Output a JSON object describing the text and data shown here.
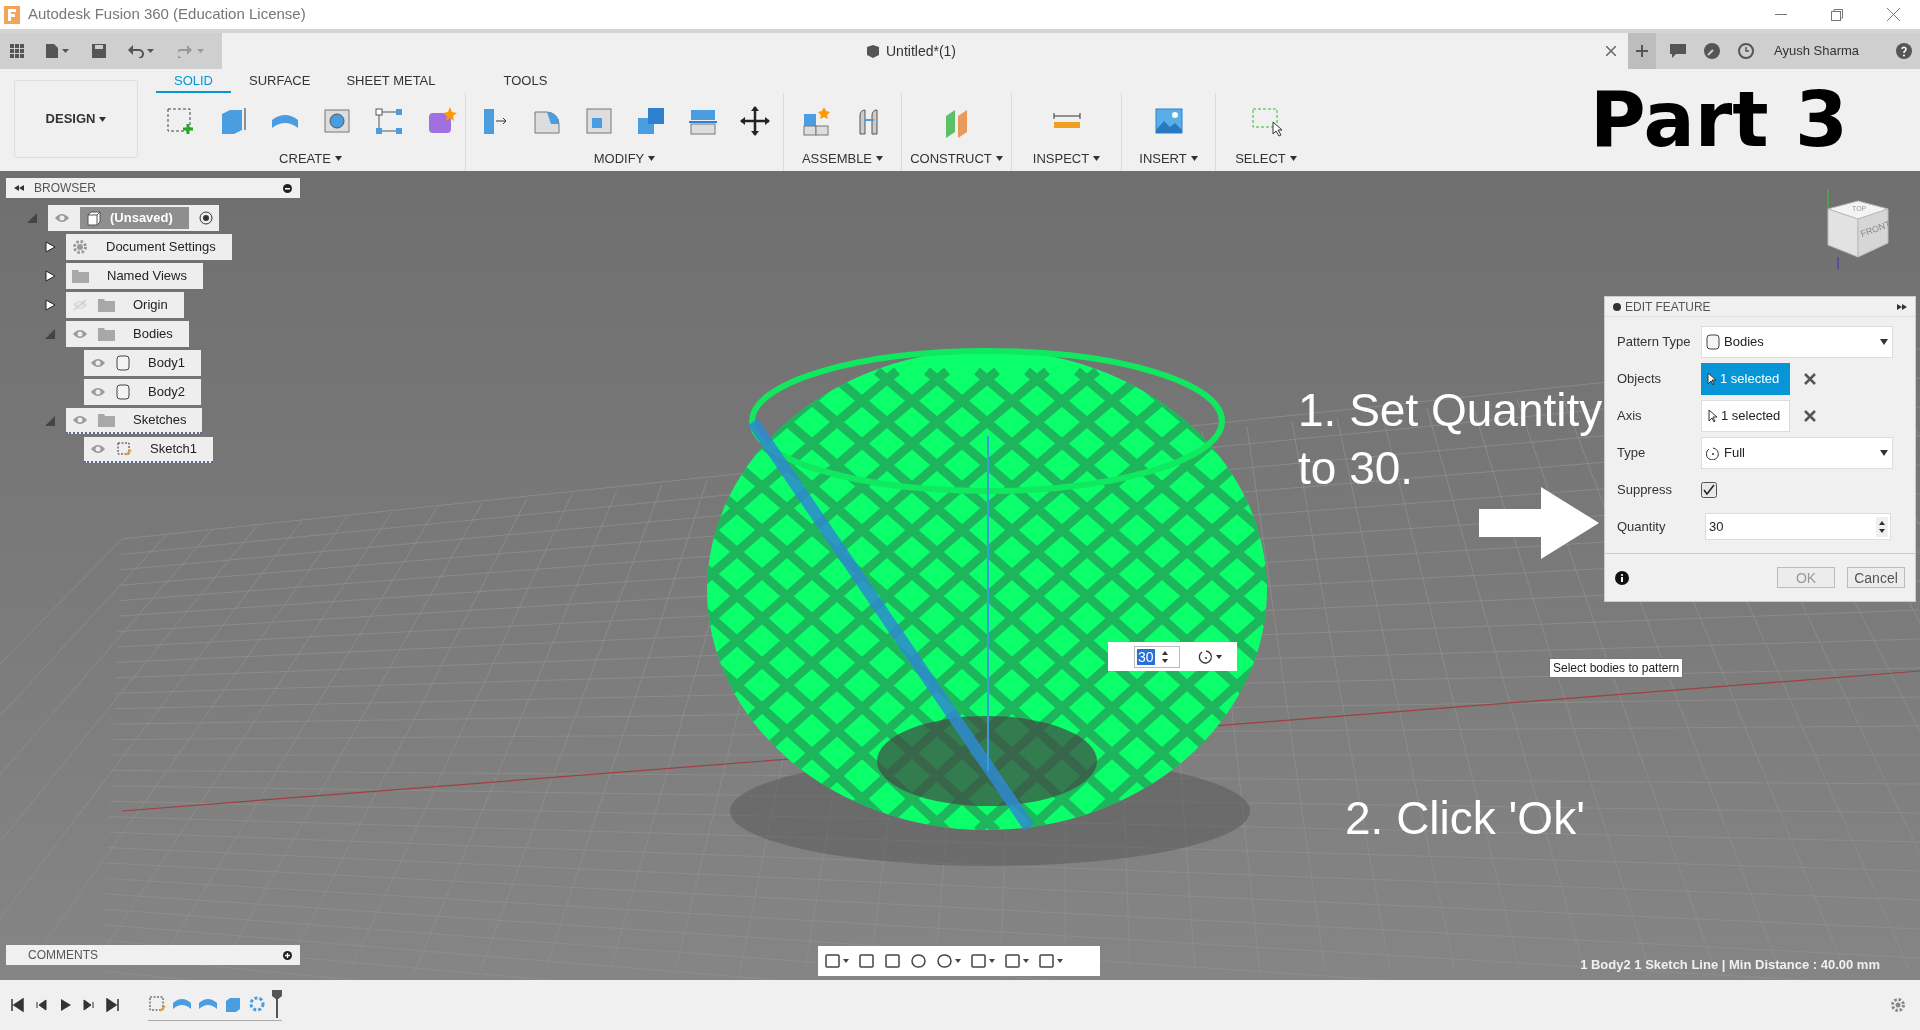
{
  "title_bar": {
    "title": "Autodesk Fusion 360 (Education License)"
  },
  "tab_bar": {
    "document_title": "Untitled*(1)",
    "user": "Ayush Sharma"
  },
  "toolbar": {
    "workspace": "DESIGN",
    "tabs": [
      {
        "label": "SOLID",
        "selected": true
      },
      {
        "label": "SURFACE",
        "selected": false
      },
      {
        "label": "SHEET METAL",
        "selected": false
      },
      {
        "label": "TOOLS",
        "selected": false
      }
    ],
    "groups": [
      {
        "label": "CREATE"
      },
      {
        "label": "MODIFY"
      },
      {
        "label": "ASSEMBLE"
      },
      {
        "label": "CONSTRUCT"
      },
      {
        "label": "INSPECT"
      },
      {
        "label": "INSERT"
      },
      {
        "label": "SELECT"
      }
    ],
    "overlay_title": "Part 3"
  },
  "browser": {
    "title": "BROWSER",
    "items": [
      {
        "label": "(Unsaved)",
        "kind": "component",
        "expanded": true,
        "visible": true,
        "children": [
          {
            "label": "Document Settings",
            "kind": "settings",
            "expanded": false
          },
          {
            "label": "Named Views",
            "kind": "views",
            "expanded": false
          },
          {
            "label": "Origin",
            "kind": "folder",
            "expanded": false,
            "visible": false
          },
          {
            "label": "Bodies",
            "kind": "folder",
            "expanded": true,
            "visible": true,
            "children": [
              {
                "label": "Body1",
                "kind": "body",
                "visible": true
              },
              {
                "label": "Body2",
                "kind": "body",
                "visible": true
              }
            ]
          },
          {
            "label": "Sketches",
            "kind": "folder",
            "expanded": true,
            "visible": true,
            "children": [
              {
                "label": "Sketch1",
                "kind": "sketch",
                "visible": true
              }
            ]
          }
        ]
      }
    ]
  },
  "viewport": {
    "annotations": [
      "1. Set Quantity to 30.",
      "2. Click 'Ok'"
    ],
    "inline_quantity": "30",
    "tooltip": "Select bodies to pattern",
    "viewcube": [
      "TOP",
      "FRONT"
    ],
    "status": "1 Body2 1 Sketch Line | Min Distance : 40.00 mm"
  },
  "edit_feature": {
    "title": "EDIT FEATURE",
    "rows": [
      {
        "kind": "dropdown",
        "label": "Pattern Type",
        "value": "Bodies"
      },
      {
        "kind": "selection",
        "label": "Objects",
        "value": "1 selected",
        "selected": true
      },
      {
        "kind": "selection",
        "label": "Axis",
        "value": "1 selected",
        "selected": false
      },
      {
        "kind": "dropdown",
        "label": "Type",
        "value": "Full"
      },
      {
        "kind": "checkbox",
        "label": "Suppress",
        "checked": true
      },
      {
        "kind": "number",
        "label": "Quantity",
        "value": "30"
      }
    ],
    "buttons": [
      "OK",
      "Cancel"
    ]
  },
  "comments": {
    "title": "COMMENTS"
  }
}
